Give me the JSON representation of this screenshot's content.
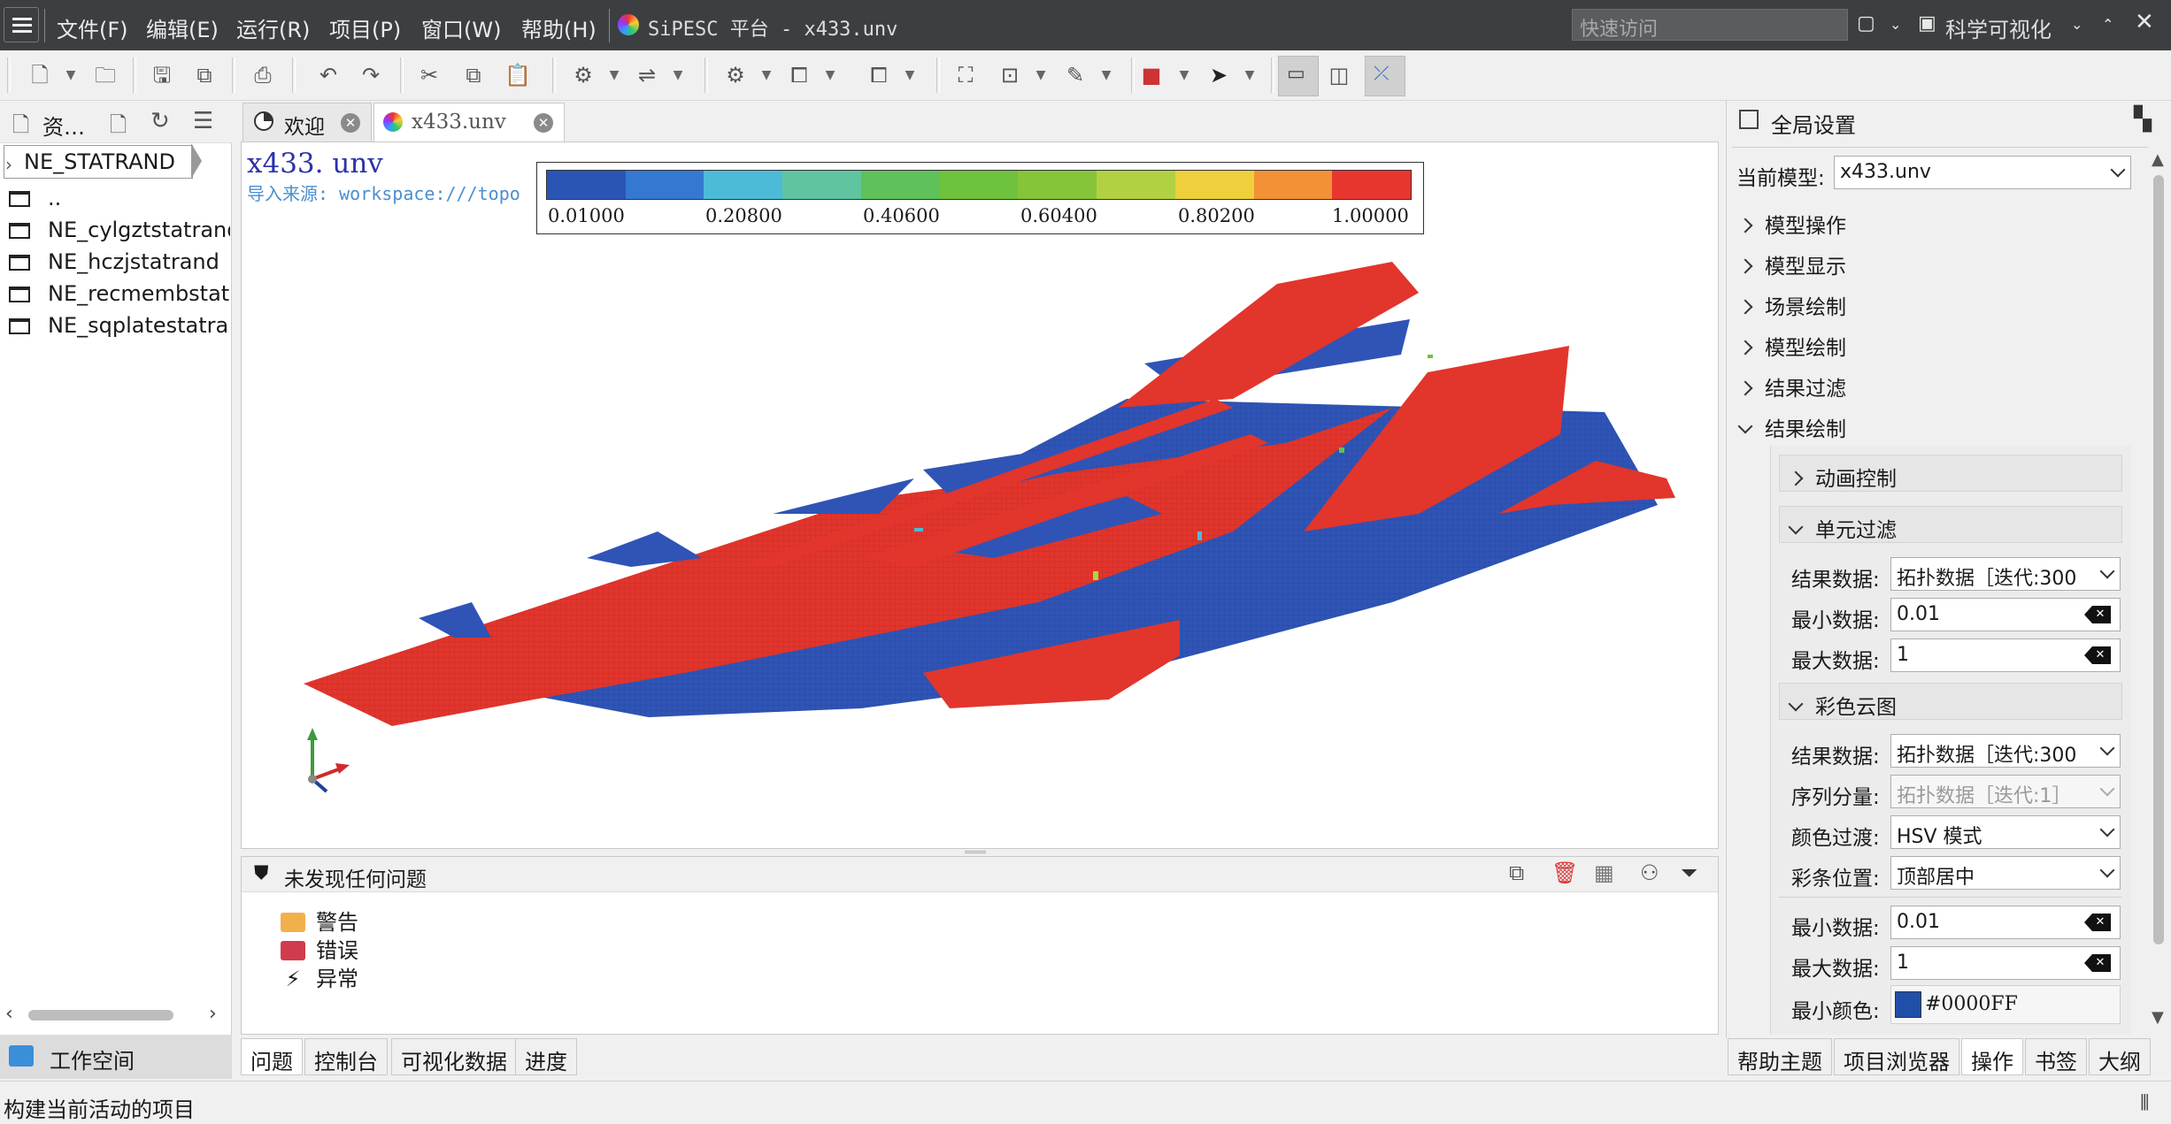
{
  "window": {
    "title": "SiPESC 平台 - x433.unv",
    "menu": [
      "文件(F)",
      "编辑(E)",
      "运行(R)",
      "项目(P)",
      "窗口(W)",
      "帮助(H)"
    ],
    "quick_access_placeholder": "快速访问",
    "perspective": "科学可视化"
  },
  "left_panel": {
    "title": "资…",
    "breadcrumb": "NE_STATRAND",
    "items": [
      "..",
      "NE_cylgztstatrand",
      "NE_hczjstatrand",
      "NE_recmembstatrand",
      "NE_sqplatestatrand"
    ],
    "bottom_tab": "工作空间"
  },
  "editor_tabs": [
    "欢迎",
    "x433.unv"
  ],
  "viewport": {
    "model_title": "x433. unv",
    "source_text": "导入来源: workspace:///topo",
    "legend": {
      "labels": [
        "0.01000",
        "0.20800",
        "0.40600",
        "0.60400",
        "0.80200",
        "1.00000"
      ],
      "colors": [
        "#2b55b4",
        "#3478d2",
        "#4cbbd8",
        "#60c4a0",
        "#5ec15a",
        "#6fc23e",
        "#86c43a",
        "#b2d142",
        "#eed03c",
        "#f39136",
        "#e8362e"
      ]
    }
  },
  "problems": {
    "header": "未发现任何问题",
    "items": [
      "警告",
      "错误",
      "异常"
    ]
  },
  "bottom_tabs": [
    "问题",
    "控制台",
    "可视化数据",
    "进度"
  ],
  "right_panel": {
    "title": "全局设置",
    "current_model_label": "当前模型:",
    "current_model_value": "x433.unv",
    "groups": [
      "模型操作",
      "模型显示",
      "场景绘制",
      "模型绘制",
      "结果过滤",
      "结果绘制"
    ],
    "anim_section": "动画控制",
    "filter_section": "单元过滤",
    "filter": {
      "result_label": "结果数据:",
      "result_value": "拓扑数据［迭代:300",
      "min_label": "最小数据:",
      "min_value": "0.01",
      "max_label": "最大数据:",
      "max_value": "1"
    },
    "contour_section": "彩色云图",
    "contour": {
      "result_label": "结果数据:",
      "result_value": "拓扑数据［迭代:300",
      "component_label": "序列分量:",
      "component_value": "拓扑数据［迭代:1］",
      "transition_label": "颜色过渡:",
      "transition_value": "HSV 模式",
      "bar_pos_label": "彩条位置:",
      "bar_pos_value": "顶部居中",
      "min_label": "最小数据:",
      "min_value": "0.01",
      "max_label": "最大数据:",
      "max_value": "1",
      "min_color_label": "最小颜色:",
      "min_color_value": "#0000FF",
      "min_color_swatch": "#1f4fa8"
    },
    "bottom_tabs": [
      "帮助主题",
      "项目浏览器",
      "操作",
      "书签",
      "大纲"
    ]
  },
  "status_bar": {
    "text": "构建当前活动的项目"
  }
}
